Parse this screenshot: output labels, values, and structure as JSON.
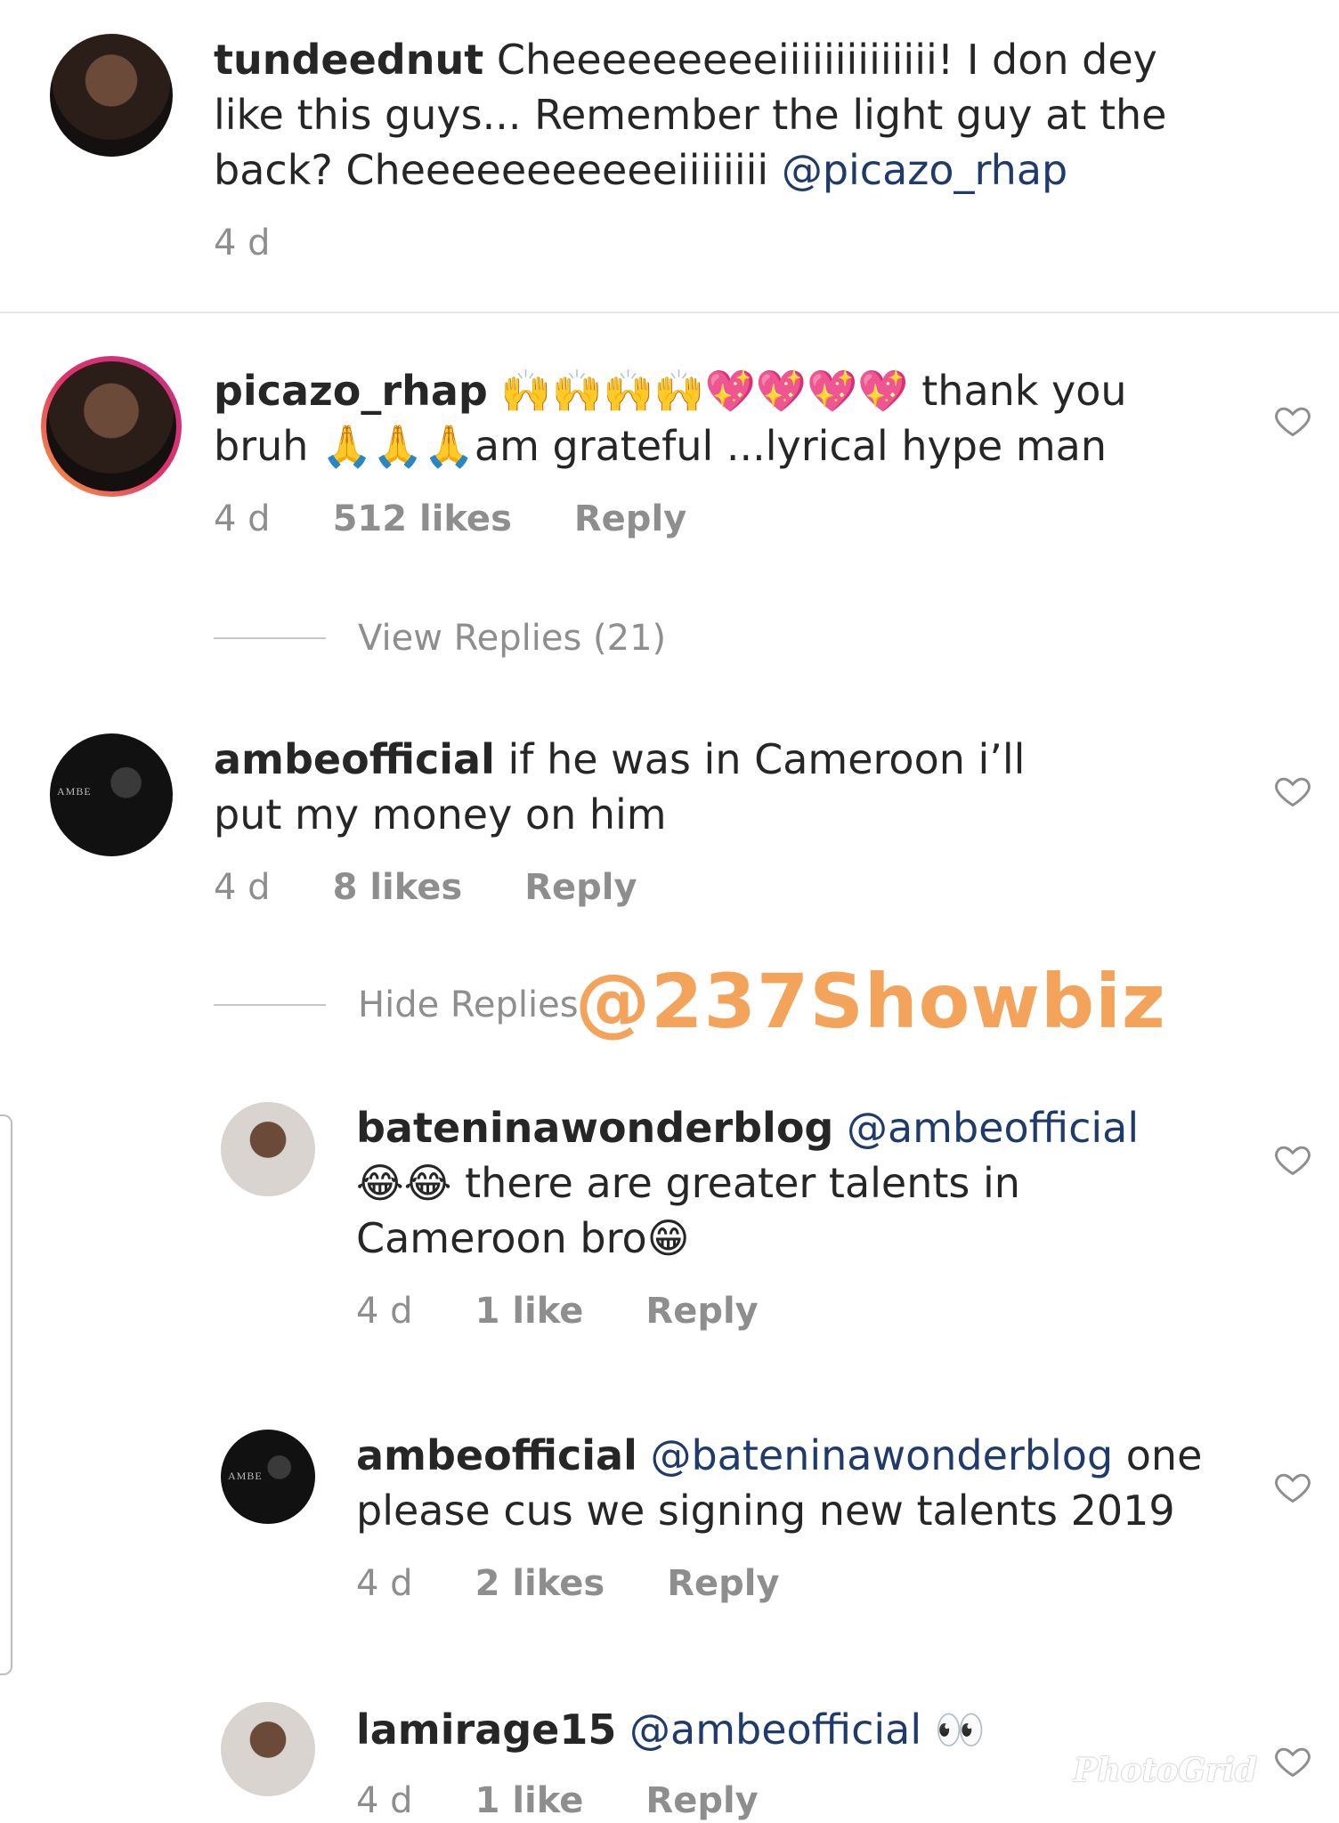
{
  "comments": [
    {
      "username": "tundeednut",
      "body": "Cheeeeeeeeeiiiiiiiiiiiiii! I don dey like this guys... Remember the light guy at the back? Cheeeeeeeeeeeiiiiiiii",
      "mention": "@picazo_rhap",
      "time": "4 d"
    },
    {
      "username": "picazo_rhap",
      "emoji_1": "🙌🙌🙌🙌💖💖💖💖",
      "body_1": "thank you",
      "body_2": "bruh",
      "emoji_2": "🙏🙏🙏",
      "body_3": "am grateful ...lyrical hype man",
      "time": "4 d",
      "likes": "512 likes",
      "reply": "Reply",
      "view_replies": "View Replies (21)"
    },
    {
      "username": "ambeofficial",
      "body": "if he was in Cameroon i’ll put my money on him",
      "time": "4 d",
      "likes": "8 likes",
      "reply": "Reply",
      "hide_replies": "Hide Replies"
    }
  ],
  "replies": [
    {
      "username": "bateninawonderblog",
      "mention": "@ambeofficial",
      "emoji_1": "😂😂",
      "body_1": "there are greater talents in",
      "body_2": "Cameroon bro",
      "emoji_2": "😁",
      "time": "4 d",
      "likes": "1 like",
      "reply": "Reply"
    },
    {
      "username": "ambeofficial",
      "mention": "@bateninawonderblog",
      "body": "one please cus we signing new talents 2019",
      "time": "4 d",
      "likes": "2 likes",
      "reply": "Reply"
    },
    {
      "username": "lamirage15",
      "mention": "@ambeofficial",
      "emoji": "👀",
      "time": "4 d",
      "likes": "1 like",
      "reply": "Reply"
    }
  ],
  "watermark": "@237Showbiz",
  "photogrid": "PhotoGrid",
  "avatar_brand": "AMBE",
  "colors": {
    "mention": "#1f3b6b",
    "meta": "#8e8e8e",
    "watermark": "#f4a35a"
  }
}
